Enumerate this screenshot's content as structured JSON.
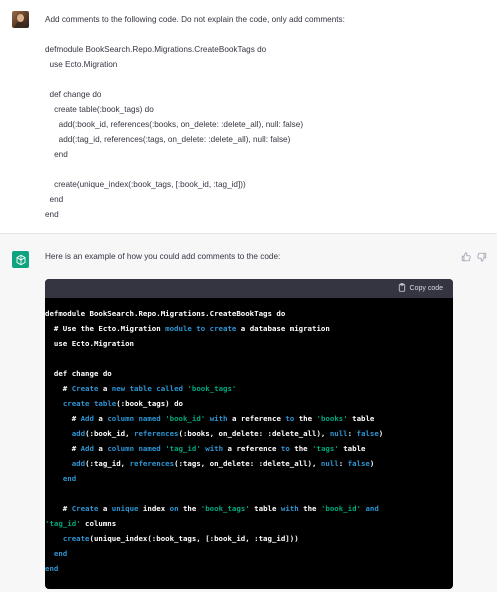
{
  "user_message": {
    "avatar": "user-avatar",
    "lines": [
      "Add comments to the following code. Do not explain the code, only add comments:",
      "",
      "defmodule BookSearch.Repo.Migrations.CreateBookTags do",
      "  use Ecto.Migration",
      "",
      "  def change do",
      "    create table(:book_tags) do",
      "      add(:book_id, references(:books, on_delete: :delete_all), null: false)",
      "      add(:tag_id, references(:tags, on_delete: :delete_all), null: false)",
      "    end",
      "",
      "    create(unique_index(:book_tags, [:book_id, :tag_id]))",
      "  end",
      "end"
    ]
  },
  "assistant_message": {
    "avatar": "openai-logo-icon",
    "intro": "Here is an example of how you could add comments to the code:",
    "copy_label": "Copy code",
    "feedback": {
      "thumbs_up": "thumbs-up-icon",
      "thumbs_down": "thumbs-down-icon"
    },
    "code_lines": [
      [
        {
          "t": "defmodule BookSearch.Repo.Migrations.CreateBookTags do",
          "c": "plain"
        }
      ],
      [
        {
          "t": "  # Use the Ecto.Migration ",
          "c": "cmt"
        },
        {
          "t": "module",
          "c": "blue"
        },
        {
          "t": " ",
          "c": "plain"
        },
        {
          "t": "to",
          "c": "blue"
        },
        {
          "t": " ",
          "c": "plain"
        },
        {
          "t": "create",
          "c": "blue"
        },
        {
          "t": " a database migration",
          "c": "cmt"
        }
      ],
      [
        {
          "t": "  use Ecto.Migration",
          "c": "plain"
        }
      ],
      [
        {
          "t": "",
          "c": "plain"
        }
      ],
      [
        {
          "t": "  def change do",
          "c": "plain"
        }
      ],
      [
        {
          "t": "    # ",
          "c": "cmt"
        },
        {
          "t": "Create",
          "c": "blue"
        },
        {
          "t": " a ",
          "c": "cmt"
        },
        {
          "t": "new",
          "c": "blue"
        },
        {
          "t": " ",
          "c": "plain"
        },
        {
          "t": "table",
          "c": "blue"
        },
        {
          "t": " ",
          "c": "plain"
        },
        {
          "t": "called",
          "c": "blue"
        },
        {
          "t": " ",
          "c": "plain"
        },
        {
          "t": "'book_tags'",
          "c": "str"
        }
      ],
      [
        {
          "t": "    ",
          "c": "plain"
        },
        {
          "t": "create",
          "c": "blue"
        },
        {
          "t": " ",
          "c": "plain"
        },
        {
          "t": "table",
          "c": "blue"
        },
        {
          "t": "(:book_tags) do",
          "c": "plain"
        }
      ],
      [
        {
          "t": "      # ",
          "c": "cmt"
        },
        {
          "t": "Add",
          "c": "blue"
        },
        {
          "t": " a ",
          "c": "cmt"
        },
        {
          "t": "column",
          "c": "blue"
        },
        {
          "t": " ",
          "c": "plain"
        },
        {
          "t": "named",
          "c": "blue"
        },
        {
          "t": " ",
          "c": "plain"
        },
        {
          "t": "'book_id'",
          "c": "str"
        },
        {
          "t": " ",
          "c": "plain"
        },
        {
          "t": "with",
          "c": "blue"
        },
        {
          "t": " a reference ",
          "c": "cmt"
        },
        {
          "t": "to",
          "c": "blue"
        },
        {
          "t": " the ",
          "c": "cmt"
        },
        {
          "t": "'books'",
          "c": "str"
        },
        {
          "t": " table",
          "c": "cmt"
        }
      ],
      [
        {
          "t": "      ",
          "c": "plain"
        },
        {
          "t": "add",
          "c": "blue"
        },
        {
          "t": "(:book_id, ",
          "c": "plain"
        },
        {
          "t": "references",
          "c": "blue"
        },
        {
          "t": "(:books, on_delete: :delete_all), ",
          "c": "plain"
        },
        {
          "t": "null",
          "c": "blue"
        },
        {
          "t": ": ",
          "c": "plain"
        },
        {
          "t": "false",
          "c": "blue"
        },
        {
          "t": ")",
          "c": "plain"
        }
      ],
      [
        {
          "t": "      # ",
          "c": "cmt"
        },
        {
          "t": "Add",
          "c": "blue"
        },
        {
          "t": " a ",
          "c": "cmt"
        },
        {
          "t": "column",
          "c": "blue"
        },
        {
          "t": " ",
          "c": "plain"
        },
        {
          "t": "named",
          "c": "blue"
        },
        {
          "t": " ",
          "c": "plain"
        },
        {
          "t": "'tag_id'",
          "c": "str"
        },
        {
          "t": " ",
          "c": "plain"
        },
        {
          "t": "with",
          "c": "blue"
        },
        {
          "t": " a reference ",
          "c": "cmt"
        },
        {
          "t": "to",
          "c": "blue"
        },
        {
          "t": " the ",
          "c": "cmt"
        },
        {
          "t": "'tags'",
          "c": "str"
        },
        {
          "t": " table",
          "c": "cmt"
        }
      ],
      [
        {
          "t": "      ",
          "c": "plain"
        },
        {
          "t": "add",
          "c": "blue"
        },
        {
          "t": "(:tag_id, ",
          "c": "plain"
        },
        {
          "t": "references",
          "c": "blue"
        },
        {
          "t": "(:tags, on_delete: :delete_all), ",
          "c": "plain"
        },
        {
          "t": "null",
          "c": "blue"
        },
        {
          "t": ": ",
          "c": "plain"
        },
        {
          "t": "false",
          "c": "blue"
        },
        {
          "t": ")",
          "c": "plain"
        }
      ],
      [
        {
          "t": "    ",
          "c": "plain"
        },
        {
          "t": "end",
          "c": "blue"
        }
      ],
      [
        {
          "t": "",
          "c": "plain"
        }
      ],
      [
        {
          "t": "    # ",
          "c": "cmt"
        },
        {
          "t": "Create",
          "c": "blue"
        },
        {
          "t": " a ",
          "c": "cmt"
        },
        {
          "t": "unique",
          "c": "blue"
        },
        {
          "t": " index ",
          "c": "cmt"
        },
        {
          "t": "on",
          "c": "blue"
        },
        {
          "t": " the ",
          "c": "cmt"
        },
        {
          "t": "'book_tags'",
          "c": "str"
        },
        {
          "t": " table ",
          "c": "cmt"
        },
        {
          "t": "with",
          "c": "blue"
        },
        {
          "t": " the ",
          "c": "cmt"
        },
        {
          "t": "'book_id'",
          "c": "str"
        },
        {
          "t": " ",
          "c": "plain"
        },
        {
          "t": "and",
          "c": "blue"
        }
      ],
      [
        {
          "t": "'tag_id'",
          "c": "str"
        },
        {
          "t": " columns",
          "c": "cmt"
        }
      ],
      [
        {
          "t": "    ",
          "c": "plain"
        },
        {
          "t": "create",
          "c": "blue"
        },
        {
          "t": "(unique_index(:book_tags, [:book_id, :tag_id]))",
          "c": "plain"
        }
      ],
      [
        {
          "t": "  ",
          "c": "plain"
        },
        {
          "t": "end",
          "c": "blue"
        }
      ],
      [
        {
          "t": "end",
          "c": "blue"
        }
      ]
    ]
  },
  "colors": {
    "code_bg": "#000000",
    "code_header_bg": "#343541",
    "keyword_blue": "#2e95d3",
    "string_green": "#00a67d",
    "assistant_bg": "#f7f7f8",
    "brand_green": "#10a37f"
  }
}
